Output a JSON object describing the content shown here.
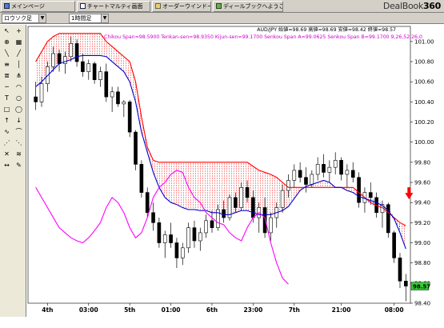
{
  "tabs": [
    {
      "label": "メインページ",
      "icon": "home-icon"
    },
    {
      "label": "チャートマルティ画面",
      "icon": "chart-window-icon"
    },
    {
      "label": "オーダーウインドー",
      "icon": "order-window-icon"
    },
    {
      "label": "ディールブックへようこそ",
      "icon": "welcome-icon"
    }
  ],
  "logo": {
    "text": "DealBook",
    "number": "360"
  },
  "toolbar": {
    "chart_type": "ロウソク足",
    "timeframe": "1時間足"
  },
  "chart": {
    "ohlc_info": "AUD/JPY 始値=98.69 高値=98.69 安値=98.42 終値=98.57",
    "ichimoku_info": "Chikou Span=98.5900 Tenkan-sen=98.9350 Kijun-sen=99.1700 Senkou Span A=99.0625 Senkou Span B=99.1700  9,26,52,26,0",
    "current_price": "98.57",
    "colors": {
      "candle_up": "#ffffff",
      "candle_down": "#000000",
      "tenkan": "#0000cc",
      "kijun": "#ff0000",
      "chikou": "#ff00ff",
      "cloud_hatch": "#ff0000",
      "cloud_hatch_down": "#0000ff",
      "price_label_bg": "#33cc33",
      "signal_arrow": "#ff0000"
    }
  },
  "chart_data": {
    "type": "candlestick",
    "pair": "AUD/JPY",
    "ylim": [
      98.4,
      101.15
    ],
    "y_ticks": [
      "101.00",
      "100.80",
      "100.60",
      "100.40",
      "100.20",
      "100.00",
      "99.80",
      "99.60",
      "99.40",
      "99.20",
      "99.00",
      "98.80",
      "98.60",
      "98.40"
    ],
    "x_ticks": [
      "4th",
      "03:00",
      "5th",
      "01:00",
      "6th",
      "23:00",
      "7th",
      "21:00",
      "08:00"
    ],
    "candles": [
      [
        100.45,
        100.6,
        100.32,
        100.4
      ],
      [
        100.4,
        100.65,
        100.35,
        100.58
      ],
      [
        100.58,
        100.8,
        100.5,
        100.75
      ],
      [
        100.75,
        100.95,
        100.7,
        100.88
      ],
      [
        100.88,
        100.92,
        100.7,
        100.78
      ],
      [
        100.78,
        100.9,
        100.68,
        100.85
      ],
      [
        100.85,
        101.05,
        100.8,
        100.98
      ],
      [
        100.98,
        101.02,
        100.75,
        100.8
      ],
      [
        100.8,
        100.88,
        100.65,
        100.7
      ],
      [
        100.7,
        100.82,
        100.62,
        100.78
      ],
      [
        100.78,
        100.8,
        100.58,
        100.62
      ],
      [
        100.62,
        100.75,
        100.55,
        100.7
      ],
      [
        100.7,
        100.78,
        100.4,
        100.45
      ],
      [
        100.45,
        100.55,
        100.3,
        100.5
      ],
      [
        100.5,
        100.55,
        100.35,
        100.38
      ],
      [
        100.38,
        100.42,
        100.25,
        100.4
      ],
      [
        100.4,
        100.42,
        100.05,
        100.1
      ],
      [
        100.1,
        100.12,
        99.72,
        99.78
      ],
      [
        99.78,
        99.82,
        99.45,
        99.5
      ],
      [
        99.5,
        99.55,
        99.25,
        99.3
      ],
      [
        99.3,
        99.4,
        99.12,
        99.2
      ],
      [
        99.2,
        99.25,
        98.95,
        99.0
      ],
      [
        99.0,
        99.12,
        98.85,
        99.08
      ],
      [
        99.08,
        99.2,
        98.95,
        99.0
      ],
      [
        99.0,
        99.05,
        98.75,
        98.85
      ],
      [
        98.85,
        99.0,
        98.78,
        98.95
      ],
      [
        98.95,
        99.2,
        98.9,
        99.15
      ],
      [
        99.15,
        99.22,
        98.95,
        99.02
      ],
      [
        99.02,
        99.15,
        98.92,
        99.1
      ],
      [
        99.1,
        99.28,
        99.05,
        99.22
      ],
      [
        99.22,
        99.32,
        99.1,
        99.15
      ],
      [
        99.15,
        99.38,
        99.12,
        99.33
      ],
      [
        99.33,
        99.42,
        99.2,
        99.25
      ],
      [
        99.25,
        99.48,
        99.22,
        99.45
      ],
      [
        99.45,
        99.5,
        99.3,
        99.35
      ],
      [
        99.35,
        99.6,
        99.32,
        99.55
      ],
      [
        99.55,
        99.62,
        99.4,
        99.45
      ],
      [
        99.45,
        99.52,
        99.2,
        99.25
      ],
      [
        99.25,
        99.4,
        99.1,
        99.35
      ],
      [
        99.35,
        99.45,
        99.05,
        99.1
      ],
      [
        99.1,
        99.3,
        99.02,
        99.25
      ],
      [
        99.25,
        99.4,
        99.15,
        99.35
      ],
      [
        99.35,
        99.58,
        99.3,
        99.52
      ],
      [
        99.52,
        99.68,
        99.45,
        99.62
      ],
      [
        99.62,
        99.78,
        99.55,
        99.72
      ],
      [
        99.72,
        99.8,
        99.6,
        99.65
      ],
      [
        99.65,
        99.75,
        99.5,
        99.58
      ],
      [
        99.58,
        99.72,
        99.55,
        99.68
      ],
      [
        99.68,
        99.85,
        99.62,
        99.78
      ],
      [
        99.78,
        99.88,
        99.65,
        99.7
      ],
      [
        99.7,
        99.82,
        99.6,
        99.75
      ],
      [
        99.75,
        99.9,
        99.68,
        99.82
      ],
      [
        99.82,
        99.85,
        99.62,
        99.68
      ],
      [
        99.68,
        99.78,
        99.55,
        99.72
      ],
      [
        99.72,
        99.8,
        99.6,
        99.65
      ],
      [
        99.65,
        99.7,
        99.35,
        99.4
      ],
      [
        99.4,
        99.55,
        99.3,
        99.5
      ],
      [
        99.5,
        99.6,
        99.38,
        99.45
      ],
      [
        99.45,
        99.5,
        99.25,
        99.3
      ],
      [
        99.3,
        99.42,
        99.15,
        99.38
      ],
      [
        99.38,
        99.4,
        99.05,
        99.1
      ],
      [
        99.1,
        99.12,
        98.8,
        98.85
      ],
      [
        98.85,
        98.9,
        98.55,
        98.62
      ],
      [
        98.62,
        98.69,
        98.42,
        98.57
      ]
    ],
    "lines": {
      "tenkan": [
        100.55,
        100.6,
        100.66,
        100.72,
        100.78,
        100.8,
        100.82,
        100.85,
        100.86,
        100.86,
        100.86,
        100.86,
        100.85,
        100.8,
        100.75,
        100.7,
        100.6,
        100.4,
        100.1,
        99.9,
        99.7,
        99.55,
        99.45,
        99.4,
        99.38,
        99.35,
        99.33,
        99.33,
        99.32,
        99.32,
        99.3,
        99.3,
        99.28,
        99.28,
        99.3,
        99.32,
        99.32,
        99.3,
        99.28,
        99.28,
        99.28,
        99.3,
        99.32,
        99.36,
        99.44,
        99.52,
        99.56,
        99.58,
        99.6,
        99.62,
        99.6,
        99.55,
        99.55,
        99.52,
        99.5,
        99.46,
        99.44,
        99.42,
        99.4,
        99.37,
        99.32,
        99.24,
        99.1,
        98.94
      ],
      "kijun": [
        100.8,
        100.9,
        101.0,
        101.05,
        101.08,
        101.08,
        101.08,
        101.08,
        101.08,
        101.08,
        101.08,
        101.08,
        101.0,
        100.95,
        100.9,
        100.85,
        100.8,
        100.6,
        100.25,
        99.95,
        99.82,
        99.8,
        99.8,
        99.8,
        99.8,
        99.8,
        99.8,
        99.8,
        99.8,
        99.8,
        99.8,
        99.8,
        99.8,
        99.8,
        99.8,
        99.8,
        99.8,
        99.76,
        99.72,
        99.7,
        99.68,
        99.65,
        99.6,
        99.55,
        99.55,
        99.55,
        99.55,
        99.55,
        99.55,
        99.55,
        99.55,
        99.55,
        99.55,
        99.55,
        99.55,
        99.5,
        99.45,
        99.4,
        99.37,
        99.35,
        99.3,
        99.25,
        99.2,
        99.17
      ],
      "chikou": [
        99.55,
        99.45,
        99.35,
        99.25,
        99.15,
        99.1,
        99.05,
        99.02,
        99.0,
        99.05,
        99.12,
        99.2,
        99.35,
        99.45,
        99.4,
        99.3,
        99.15,
        99.05,
        99.1,
        99.25,
        99.45,
        99.55,
        99.6,
        99.68,
        99.72,
        99.7,
        99.55,
        99.45,
        99.4,
        99.3,
        99.25,
        99.2,
        99.18,
        99.1,
        99.05,
        99.02,
        99.15,
        99.25,
        99.3,
        99.25,
        99.0,
        98.8,
        98.65,
        98.59
      ]
    }
  }
}
